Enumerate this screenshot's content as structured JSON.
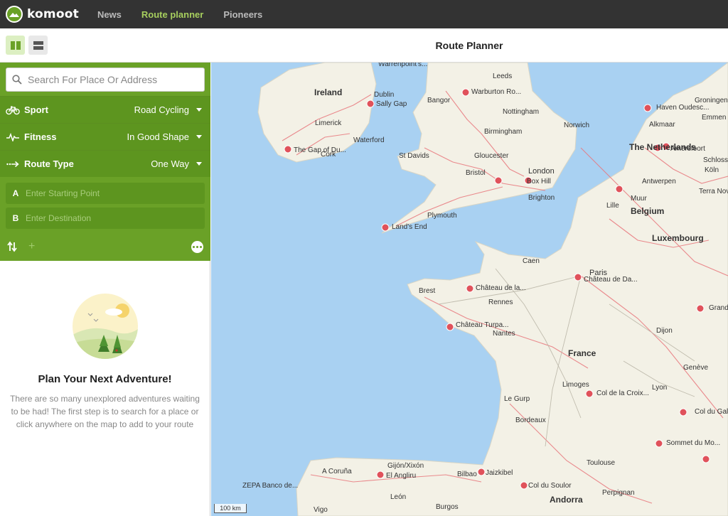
{
  "app": {
    "logo_text": "komoot",
    "nav": [
      {
        "label": "News",
        "active": false
      },
      {
        "label": "Route planner",
        "active": true
      },
      {
        "label": "Pioneers",
        "active": false
      }
    ]
  },
  "toolbar": {
    "title": "Route Planner"
  },
  "planner": {
    "search_placeholder": "Search For Place Or Address",
    "sport": {
      "label": "Sport",
      "value": "Road Cycling",
      "icon": "bike-icon"
    },
    "fitness": {
      "label": "Fitness",
      "value": "In Good Shape",
      "icon": "pulse-icon"
    },
    "route_type": {
      "label": "Route Type",
      "value": "One Way",
      "icon": "one-way-arrow-icon"
    },
    "start": {
      "letter": "A",
      "placeholder": "Enter Starting Point"
    },
    "destination": {
      "letter": "B",
      "placeholder": "Enter Destination"
    },
    "footer_add": "+"
  },
  "empty_state": {
    "title": "Plan Your Next Adventure!",
    "text": "There are so many unexplored adventures waiting to be had! The first step is to search for a place or click anywhere on the map to add to your route"
  },
  "map": {
    "countries": [
      "Ireland",
      "France",
      "Belgium",
      "Luxembourg",
      "The Netherlands",
      "Andorra"
    ],
    "capitals": [
      "London",
      "Paris"
    ],
    "cities": [
      "Dublin",
      "Sally Gap",
      "Limerick",
      "Waterford",
      "Cork",
      "The Gap of Du...",
      "Bangor",
      "Leeds",
      "Warburton Ro...",
      "Nottingham",
      "Birmingham",
      "Norwich",
      "St Davids",
      "Gloucester",
      "Bristol",
      "Box Hill",
      "Brighton",
      "Plymouth",
      "Land's End",
      "Warrenpoint's...",
      "Haven Oudesc...",
      "Groningen",
      "Emmen",
      "Alkmaar",
      "Amersfoort",
      "Schloss",
      "Köln",
      "Antwerpen",
      "Terra Nova",
      "Lille",
      "Muur",
      "Caen",
      "Château de Da...",
      "Brest",
      "Château de la...",
      "Rennes",
      "Château Turpa...",
      "Nantes",
      "Dijon",
      "Grand",
      "Limoges",
      "Col de la Croix...",
      "Lyon",
      "Genève",
      "Le Gurp",
      "Bordeaux",
      "Col du Gal",
      "Sommet du Mo...",
      "Toulouse",
      "Gijón/Xixón",
      "A Coruña",
      "El Angliru",
      "Bilbao",
      "Jaizkibel",
      "Col du Soulor",
      "Perpignan",
      "León",
      "Burgos",
      "Vigo",
      "ZEPA Banco de..."
    ],
    "scale": "100 km"
  },
  "colors": {
    "brand_green": "#6aa127",
    "topbar": "#333333",
    "nav_active": "#a7cf5e"
  }
}
